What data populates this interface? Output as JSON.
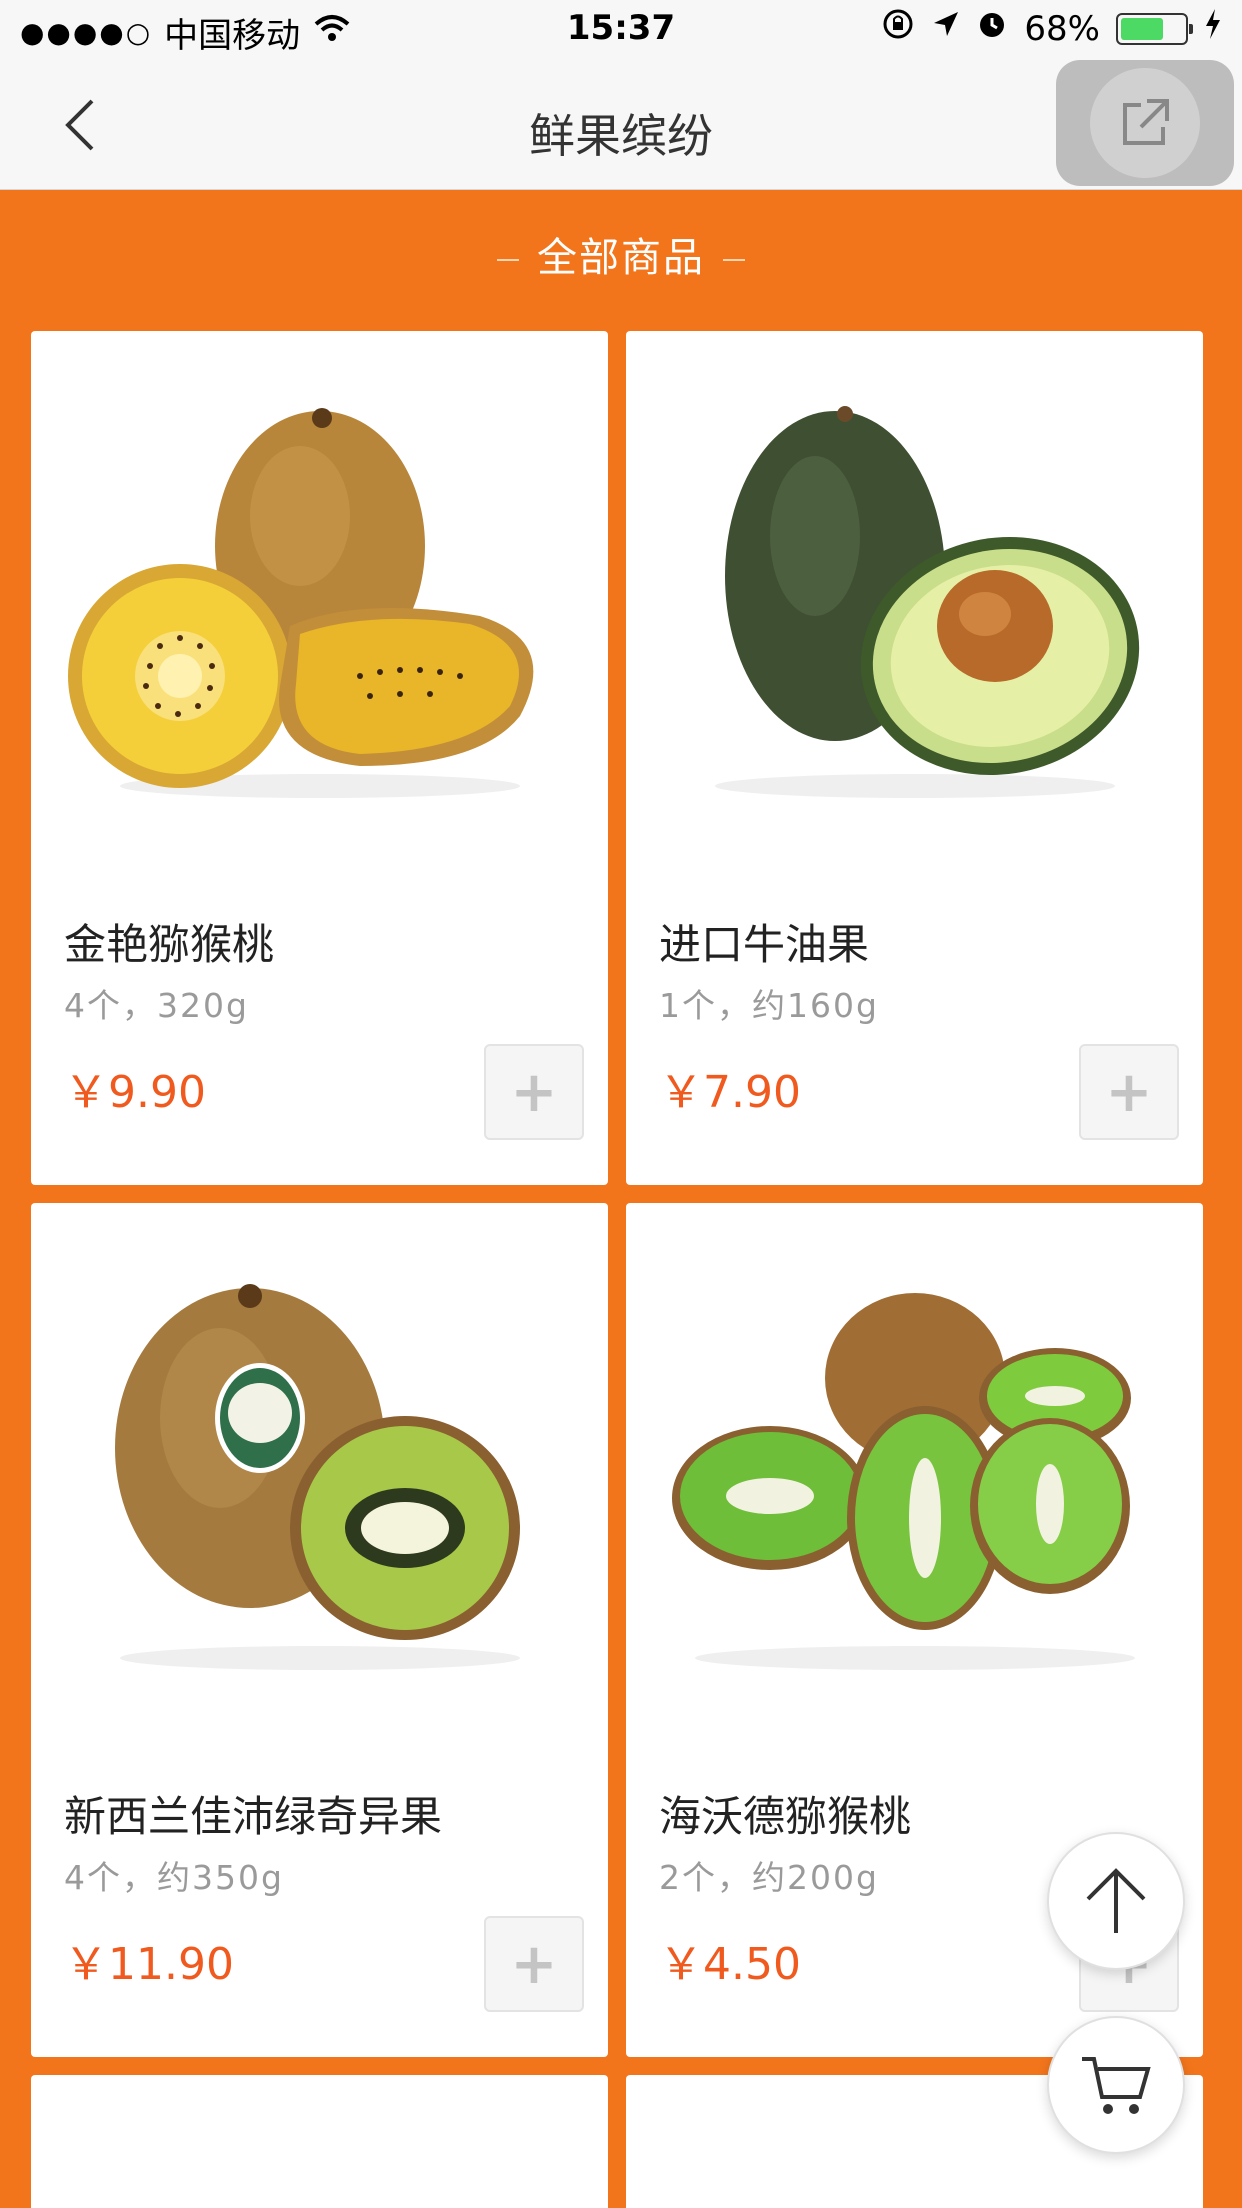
{
  "status_bar": {
    "signal": "●●●●○",
    "carrier": "中国移动",
    "time": "15:37",
    "battery": "68%",
    "battery_level": 0.68
  },
  "nav": {
    "title": "鲜果缤纷"
  },
  "section": {
    "title": "全部商品"
  },
  "products": [
    {
      "name": "金艳猕猴桃",
      "spec": "4个，320g",
      "price": "￥9.90",
      "add_label": "+",
      "image_icon": "golden-kiwi-icon"
    },
    {
      "name": "进口牛油果",
      "spec": "1个，约160g",
      "price": "￥7.90",
      "add_label": "+",
      "image_icon": "avocado-icon"
    },
    {
      "name": "新西兰佳沛绿奇异果",
      "spec": "4个，约350g",
      "price": "￥11.90",
      "add_label": "+",
      "image_icon": "green-kiwi-icon"
    },
    {
      "name": "海沃德猕猴桃",
      "spec": "2个，约200g",
      "price": "￥4.50",
      "add_label": "+",
      "image_icon": "hayward-kiwi-icon"
    }
  ],
  "colors": {
    "accent": "#F2751C",
    "price": "#F05A1E"
  }
}
